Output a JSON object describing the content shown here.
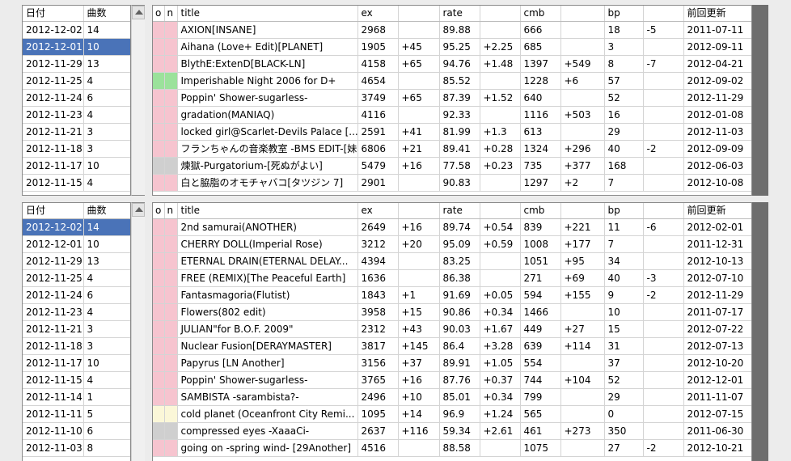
{
  "date_list_headers": {
    "date": "日付",
    "count": "曲数"
  },
  "date_list_top": [
    {
      "date": "2012-12-02",
      "count": "14"
    },
    {
      "date": "2012-12-01",
      "count": "10"
    },
    {
      "date": "2012-11-29",
      "count": "13"
    },
    {
      "date": "2012-11-25",
      "count": "4"
    },
    {
      "date": "2012-11-24",
      "count": "6"
    },
    {
      "date": "2012-11-23",
      "count": "4"
    },
    {
      "date": "2012-11-21",
      "count": "3"
    },
    {
      "date": "2012-11-18",
      "count": "3"
    },
    {
      "date": "2012-11-17",
      "count": "10"
    },
    {
      "date": "2012-11-15",
      "count": "4"
    }
  ],
  "date_list_bottom": [
    {
      "date": "2012-12-02",
      "count": "14"
    },
    {
      "date": "2012-12-01",
      "count": "10"
    },
    {
      "date": "2012-11-29",
      "count": "13"
    },
    {
      "date": "2012-11-25",
      "count": "4"
    },
    {
      "date": "2012-11-24",
      "count": "6"
    },
    {
      "date": "2012-11-23",
      "count": "4"
    },
    {
      "date": "2012-11-21",
      "count": "3"
    },
    {
      "date": "2012-11-18",
      "count": "3"
    },
    {
      "date": "2012-11-17",
      "count": "10"
    },
    {
      "date": "2012-11-15",
      "count": "4"
    },
    {
      "date": "2012-11-14",
      "count": "1"
    },
    {
      "date": "2012-11-11",
      "count": "5"
    },
    {
      "date": "2012-11-10",
      "count": "6"
    },
    {
      "date": "2012-11-03",
      "count": "8"
    }
  ],
  "score_headers": {
    "o": "o",
    "n": "n",
    "title": "title",
    "ex": "ex",
    "ex_diff": "",
    "rate": "rate",
    "rate_diff": "",
    "cmb": "cmb",
    "cmb_diff": "",
    "bp": "bp",
    "bp_diff": "",
    "prev": "前回更新"
  },
  "scores_top": [
    {
      "mark": "pink",
      "title": "AXION[INSANE]",
      "ex": "2968",
      "ex_diff": "",
      "rate": "89.88",
      "rate_diff": "",
      "cmb": "666",
      "cmb_diff": "",
      "bp": "18",
      "bp_diff": "-5",
      "prev": "2011-07-11"
    },
    {
      "mark": "pink",
      "title": "Aihana (Love+ Edit)[PLANET]",
      "ex": "1905",
      "ex_diff": "+45",
      "rate": "95.25",
      "rate_diff": "+2.25",
      "cmb": "685",
      "cmb_diff": "",
      "bp": "3",
      "bp_diff": "",
      "prev": "2012-09-11"
    },
    {
      "mark": "pink",
      "title": "BlythE:ExtenD[BLACK-LN]",
      "ex": "4158",
      "ex_diff": "+65",
      "rate": "94.76",
      "rate_diff": "+1.48",
      "cmb": "1397",
      "cmb_diff": "+549",
      "bp": "8",
      "bp_diff": "-7",
      "prev": "2012-04-21"
    },
    {
      "mark": "green",
      "title": "Imperishable Night 2006 for D+",
      "ex": "4654",
      "ex_diff": "",
      "rate": "85.52",
      "rate_diff": "",
      "cmb": "1228",
      "cmb_diff": "+6",
      "bp": "57",
      "bp_diff": "",
      "prev": "2012-09-02"
    },
    {
      "mark": "pink",
      "title": "Poppin' Shower-sugarless-",
      "ex": "3749",
      "ex_diff": "+65",
      "rate": "87.39",
      "rate_diff": "+1.52",
      "cmb": "640",
      "cmb_diff": "",
      "bp": "52",
      "bp_diff": "",
      "prev": "2012-11-29"
    },
    {
      "mark": "pink",
      "title": "gradation(MANIAQ)",
      "ex": "4116",
      "ex_diff": "",
      "rate": "92.33",
      "rate_diff": "",
      "cmb": "1116",
      "cmb_diff": "+503",
      "bp": "16",
      "bp_diff": "",
      "prev": "2012-01-08"
    },
    {
      "mark": "pink",
      "title": "locked girl@Scarlet-Devils Palace [...",
      "ex": "2591",
      "ex_diff": "+41",
      "rate": "81.99",
      "rate_diff": "+1.3",
      "cmb": "613",
      "cmb_diff": "",
      "bp": "29",
      "bp_diff": "",
      "prev": "2012-11-03"
    },
    {
      "mark": "pink",
      "title": "フランちゃんの音楽教室 -BMS EDIT-[妹...",
      "ex": "6806",
      "ex_diff": "+21",
      "rate": "89.41",
      "rate_diff": "+0.28",
      "cmb": "1324",
      "cmb_diff": "+296",
      "bp": "40",
      "bp_diff": "-2",
      "prev": "2012-09-09"
    },
    {
      "mark": "gray",
      "title": "煉獄-Purgatorium-[死ぬがよい]",
      "ex": "5479",
      "ex_diff": "+16",
      "rate": "77.58",
      "rate_diff": "+0.23",
      "cmb": "735",
      "cmb_diff": "+377",
      "bp": "168",
      "bp_diff": "",
      "prev": "2012-06-03"
    },
    {
      "mark": "pink",
      "title": "白と脇脂のオモチャバコ[タツジン 7]",
      "ex": "2901",
      "ex_diff": "",
      "rate": "90.83",
      "rate_diff": "",
      "cmb": "1297",
      "cmb_diff": "+2",
      "bp": "7",
      "bp_diff": "",
      "prev": "2012-10-08"
    }
  ],
  "scores_bottom": [
    {
      "mark": "pink",
      "title": "2nd samurai(ANOTHER)",
      "ex": "2649",
      "ex_diff": "+16",
      "rate": "89.74",
      "rate_diff": "+0.54",
      "cmb": "839",
      "cmb_diff": "+221",
      "bp": "11",
      "bp_diff": "-6",
      "prev": "2012-02-01"
    },
    {
      "mark": "pink",
      "title": "CHERRY DOLL(Imperial Rose)",
      "ex": "3212",
      "ex_diff": "+20",
      "rate": "95.09",
      "rate_diff": "+0.59",
      "cmb": "1008",
      "cmb_diff": "+177",
      "bp": "7",
      "bp_diff": "",
      "prev": "2011-12-31"
    },
    {
      "mark": "pink",
      "title": "ETERNAL DRAIN(ETERNAL DELAY...",
      "ex": "4394",
      "ex_diff": "",
      "rate": "83.25",
      "rate_diff": "",
      "cmb": "1051",
      "cmb_diff": "+95",
      "bp": "34",
      "bp_diff": "",
      "prev": "2012-10-13"
    },
    {
      "mark": "pink",
      "title": "FREE (REMIX)[The Peaceful Earth]",
      "ex": "1636",
      "ex_diff": "",
      "rate": "86.38",
      "rate_diff": "",
      "cmb": "271",
      "cmb_diff": "+69",
      "bp": "40",
      "bp_diff": "-3",
      "prev": "2012-07-10"
    },
    {
      "mark": "pink",
      "title": "Fantasmagoria(Flutist)",
      "ex": "1843",
      "ex_diff": "+1",
      "rate": "91.69",
      "rate_diff": "+0.05",
      "cmb": "594",
      "cmb_diff": "+155",
      "bp": "9",
      "bp_diff": "-2",
      "prev": "2012-11-29"
    },
    {
      "mark": "pink",
      "title": "Flowers(802 edit)",
      "ex": "3958",
      "ex_diff": "+15",
      "rate": "90.86",
      "rate_diff": "+0.34",
      "cmb": "1466",
      "cmb_diff": "",
      "bp": "10",
      "bp_diff": "",
      "prev": "2011-07-17"
    },
    {
      "mark": "pink",
      "title": "JULIAN\"for B.O.F. 2009\"",
      "ex": "2312",
      "ex_diff": "+43",
      "rate": "90.03",
      "rate_diff": "+1.67",
      "cmb": "449",
      "cmb_diff": "+27",
      "bp": "15",
      "bp_diff": "",
      "prev": "2012-07-22"
    },
    {
      "mark": "pink",
      "title": "Nuclear Fusion[DERAYMASTER]",
      "ex": "3817",
      "ex_diff": "+145",
      "rate": "86.4",
      "rate_diff": "+3.28",
      "cmb": "639",
      "cmb_diff": "+114",
      "bp": "31",
      "bp_diff": "",
      "prev": "2012-07-13"
    },
    {
      "mark": "pink",
      "title": "Papyrus [LN Another]",
      "ex": "3156",
      "ex_diff": "+37",
      "rate": "89.91",
      "rate_diff": "+1.05",
      "cmb": "554",
      "cmb_diff": "",
      "bp": "37",
      "bp_diff": "",
      "prev": "2012-10-20"
    },
    {
      "mark": "pink",
      "title": "Poppin' Shower-sugarless-",
      "ex": "3765",
      "ex_diff": "+16",
      "rate": "87.76",
      "rate_diff": "+0.37",
      "cmb": "744",
      "cmb_diff": "+104",
      "bp": "52",
      "bp_diff": "",
      "prev": "2012-12-01"
    },
    {
      "mark": "pink",
      "title": "SAMBISTA -sarambista?-",
      "ex": "2496",
      "ex_diff": "+10",
      "rate": "85.01",
      "rate_diff": "+0.34",
      "cmb": "799",
      "cmb_diff": "",
      "bp": "29",
      "bp_diff": "",
      "prev": "2011-11-07"
    },
    {
      "mark": "cream",
      "title": "cold planet (Oceanfront City Remi...",
      "ex": "1095",
      "ex_diff": "+14",
      "rate": "96.9",
      "rate_diff": "+1.24",
      "cmb": "565",
      "cmb_diff": "",
      "bp": "0",
      "bp_diff": "",
      "prev": "2012-07-15"
    },
    {
      "mark": "gray",
      "title": "compressed eyes -XaaaCi-",
      "ex": "2637",
      "ex_diff": "+116",
      "rate": "59.34",
      "rate_diff": "+2.61",
      "cmb": "461",
      "cmb_diff": "+273",
      "bp": "350",
      "bp_diff": "",
      "prev": "2011-06-30"
    },
    {
      "mark": "pink",
      "title": "going on -spring wind- [29Another]",
      "ex": "4516",
      "ex_diff": "",
      "rate": "88.58",
      "rate_diff": "",
      "cmb": "1075",
      "cmb_diff": "",
      "bp": "27",
      "bp_diff": "-2",
      "prev": "2012-10-21"
    }
  ],
  "colors": {
    "selection": "#4a73b8",
    "pink": "#f6c4cf",
    "green": "#9be29b",
    "gray": "#cfcfcf",
    "cream": "#fbf7d8"
  },
  "selected_index_top": 1,
  "selected_index_bottom": 0
}
